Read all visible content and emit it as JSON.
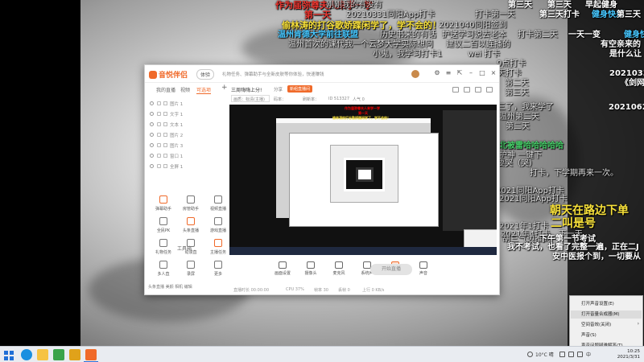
{
  "danmaku": [
    {
      "text": "作为届弥尊夫人来学一学",
      "cls": "red"
    },
    {
      "text": "刚刚我的有没有",
      "cls": "dim"
    },
    {
      "text": "第三天",
      "cls": ""
    },
    {
      "text": "第三天",
      "cls": ""
    },
    {
      "text": "早起健身",
      "cls": ""
    },
    {
      "text": "第一天",
      "cls": "red"
    },
    {
      "text": "20210331同阳App打卡",
      "cls": "dim"
    },
    {
      "text": "打卡第一天",
      "cls": "dim"
    },
    {
      "text": "第三天打卡",
      "cls": ""
    },
    {
      "text": "健身快乐",
      "cls": "cyan"
    },
    {
      "text": "第三天",
      "cls": ""
    },
    {
      "text": "偷林涛的打谷歌娇蹀闲学了，学不会的！",
      "cls": "yellow"
    },
    {
      "text": "2021040同阳签到",
      "cls": "dim"
    },
    {
      "text": "温州肯德大学前往联盟",
      "cls": "cyan"
    },
    {
      "text": "历史书来的有话",
      "cls": "dim"
    },
    {
      "text": "护送学习说去老本",
      "cls": "dim"
    },
    {
      "text": "打卡第二天",
      "cls": "dim"
    },
    {
      "text": "一天一变",
      "cls": ""
    },
    {
      "text": "健身快",
      "cls": "cyan"
    },
    {
      "text": "温州首次的课代我一个",
      "cls": "dim"
    },
    {
      "text": "云梦大学实际想问",
      "cls": "dim"
    },
    {
      "text": "建议二百以连播的",
      "cls": "dim"
    },
    {
      "text": "有空亲来的",
      "cls": ""
    },
    {
      "text": "小鬼，我学习打卡1",
      "cls": "dim"
    },
    {
      "text": "wei 打卡",
      "cls": "dim"
    },
    {
      "text": "是什么让",
      "cls": ""
    },
    {
      "text": "9点打卡",
      "cls": "dim"
    },
    {
      "text": "20210330阳",
      "cls": ""
    },
    {
      "text": "《剑网数据",
      "cls": ""
    },
    {
      "text": "第二天打卡",
      "cls": "dim"
    },
    {
      "text": "第二天",
      "cls": "dim"
    },
    {
      "text": "第三天",
      "cls": "dim"
    },
    {
      "text": "三了，我来学了",
      "cls": "dim"
    },
    {
      "text": "20210627阳",
      "cls": ""
    },
    {
      "text": "温州第二天",
      "cls": "dim"
    },
    {
      "text": "第二天",
      "cls": "dim"
    },
    {
      "text": "北被雷哈哈哈哈哈",
      "cls": "green"
    },
    {
      "text": "护神 一键下",
      "cls": "dim"
    },
    {
      "text": "要哭（哭）",
      "cls": "dim"
    },
    {
      "text": "打卡，下学期再来一次。",
      "cls": "dim"
    },
    {
      "text": "2021同阳App打卡",
      "cls": "dim"
    },
    {
      "text": "2021同阳App打卡",
      "cls": "dim"
    },
    {
      "text": "朝天在路边下单",
      "cls": "big"
    },
    {
      "text": "二叫是号",
      "cls": "big"
    },
    {
      "text": "2021年1打卡",
      "cls": "dim"
    },
    {
      "text": "2021年4打卡，下一天",
      "cls": "dim"
    },
    {
      "text": "胡三气边推到",
      "cls": "dim"
    },
    {
      "text": "下午第一节考试",
      "cls": ""
    },
    {
      "text": "我不考试，也看了完整一遍，正在二J",
      "cls": ""
    },
    {
      "text": "安中医报个到，一切要从",
      "cls": ""
    }
  ],
  "app": {
    "logo": "音悦伴侣",
    "chip": "体验",
    "notice": "礼物任务、弹幕助手与全新皮肤等你体验，快速赚钱",
    "tabs": [
      "我的直播",
      "视频",
      "可选项"
    ],
    "scenes": [
      "图片 1",
      "文字 1",
      "文本 1",
      "图片 2",
      "图片 3",
      "窗口 1",
      "全屏 1"
    ],
    "tools_title": "工具箱",
    "tools": [
      "弹幕助手",
      "房管助手",
      "视频直播",
      "全民PK",
      "头条直播",
      "游戏直播",
      "礼物任务",
      "动漫直",
      "主播任务",
      "多人直",
      "录屏",
      "更多"
    ],
    "left_footer": "头条直播 美颜 相机 编辑",
    "room_title": "三周嗨嗨上分!",
    "room_share": "分享",
    "room_badge": "新组直播间",
    "info_items": [
      "画质：标清(主播)",
      "码率：",
      "刷新率：",
      "ID 513327",
      "人气 0"
    ],
    "bottom_tools": [
      "画面设置",
      "摄像头",
      "麦克风",
      "系统声",
      "麦克风",
      "声音"
    ],
    "live_button": "开始直播",
    "status_items": [
      "直播时长 00:00:00",
      "CPU 37%",
      "帧率 30",
      "丢帧 0",
      "上行 0 KB/s"
    ]
  },
  "preview": {
    "overlay_text": [
      "作为届弥尊夫人来学一学",
      "偷林涛的打谷歌娇蹀闲学了，学不会的！",
      "第一天"
    ]
  },
  "context_menu": {
    "items": [
      "打开声音设置(E)",
      "打开音量合成器(M)",
      "空间音效(关闭)",
      "声音(S)",
      "声音问题疑难解答(T)"
    ],
    "highlighted": 1
  },
  "taskbar": {
    "weather": "10°C 晴",
    "lang": "中",
    "time": "10:25",
    "date": "2021/3/31"
  },
  "colors": {
    "brand": "#f06a2a",
    "danmaku_red": "#e8352f",
    "danmaku_yellow": "#f7e03a",
    "danmaku_green": "#48d06a",
    "danmaku_cyan": "#46c7ff"
  }
}
